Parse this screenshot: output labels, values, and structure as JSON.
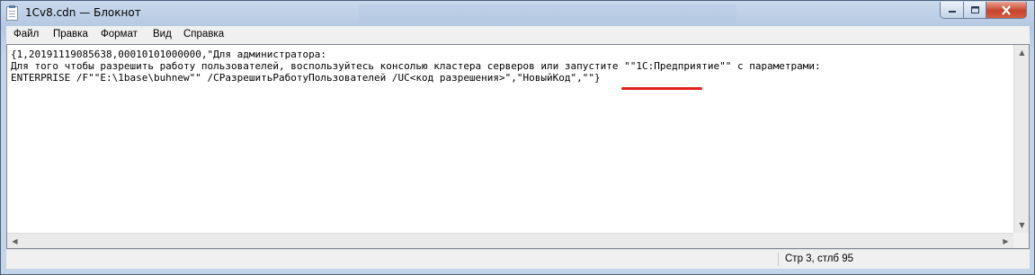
{
  "window": {
    "title": "1Cv8.cdn — Блокнот"
  },
  "menu": {
    "items": [
      "Файл",
      "Правка",
      "Формат",
      "Вид",
      "Справка"
    ]
  },
  "editor": {
    "lines": [
      "{1,20191119085638,00010101000000,\"Для администратора:",
      "Для того чтобы разрешить работу пользователей, воспользуйтесь консолью кластера серверов или запустите \"\"1С:Предприятие\"\" с параметрами:",
      "ENTERPRISE /F\"\"E:\\1base\\buhnew\"\" /СРазрешитьРаботуПользователей /UC<код разрешения>\",\"НовыйКод\",\"\"}"
    ],
    "highlight_color": "#e0201c"
  },
  "status": {
    "position": "Стр 3, стлб 95"
  },
  "colors": {
    "titlebar": "#c9d9ec",
    "close_button": "#c7422b"
  }
}
